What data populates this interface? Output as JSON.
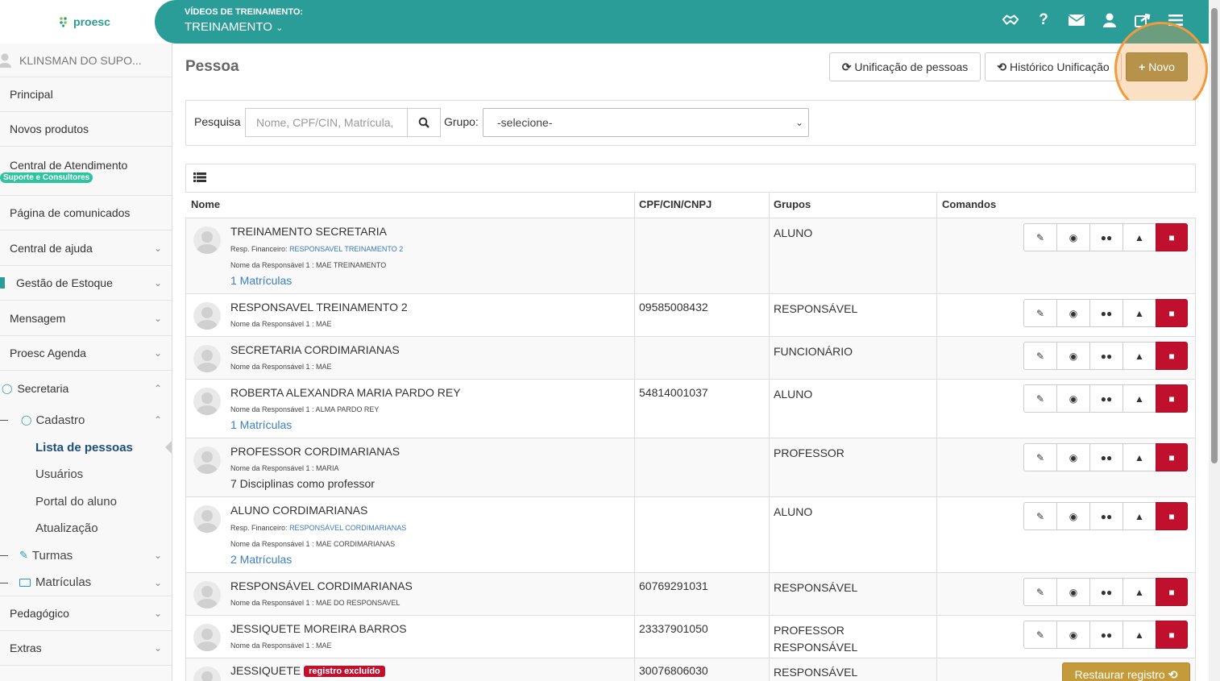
{
  "header": {
    "logo_text": "proesc",
    "video_label": "VÍDEOS DE TREINAMENTO:",
    "video_select": "TREINAMENTO",
    "icons": [
      "handshake-icon",
      "help-icon",
      "envelope-icon",
      "user-icon",
      "share-icon",
      "menu-icon"
    ]
  },
  "sidebar": {
    "user": "KLINSMAN DO SUPO...",
    "items": [
      {
        "label": "Principal"
      },
      {
        "label": "Novos produtos"
      },
      {
        "label": "Central de Atendimento",
        "badge": "Suporte e Consultores"
      },
      {
        "label": "Página de comunicados"
      },
      {
        "label": "Central de ajuda"
      },
      {
        "label": "Gestão de Estoque"
      },
      {
        "label": "Mensagem"
      },
      {
        "label": "Proesc Agenda"
      },
      {
        "label": "Secretaria"
      }
    ],
    "cadastro": "Cadastro",
    "sub_items": [
      "Lista de pessoas",
      "Usuários",
      "Portal do aluno",
      "Atualização"
    ],
    "turmas": "Turmas",
    "matriculas": "Matrículas",
    "pedagogico": "Pedagógico",
    "extras": "Extras"
  },
  "main": {
    "title": "Pessoa",
    "btn_unificacao": "Unificação de pessoas",
    "btn_historico": "Histórico Unificação",
    "btn_novo": "Novo",
    "search_label": "Pesquisa",
    "search_placeholder": "Nome, CPF/CIN, Matrícula,",
    "group_label": "Grupo:",
    "group_value": "-selecione-",
    "columns": [
      "Nome",
      "CPF/CIN/CNPJ",
      "Grupos",
      "Comandos"
    ],
    "restore_label": "Restaurar registro",
    "deleted_badge": "registro excluído"
  },
  "rows": [
    {
      "name": "TREINAMENTO SECRETARIA",
      "resp_fin_label": "Resp. Financeiro:",
      "resp_fin": "RESPONSAVEL TREINAMENTO 2",
      "resp": "Nome da Responsável 1 : MAE TREINAMENTO",
      "extra": "1 Matrículas",
      "cpf": "",
      "groups": [
        "ALUNO"
      ]
    },
    {
      "name": "RESPONSAVEL TREINAMENTO 2",
      "resp": "Nome da Responsável 1 : MAE",
      "cpf": "09585008432",
      "groups": [
        "RESPONSÁVEL"
      ]
    },
    {
      "name": "SECRETARIA CORDIMARIANAS",
      "resp": "Nome da Responsável 1 : MAE",
      "cpf": "",
      "groups": [
        "FUNCIONÁRIO"
      ]
    },
    {
      "name": "ROBERTA ALEXANDRA MARIA PARDO REY",
      "resp": "Nome da Responsável 1 : ALMA PARDO REY",
      "extra": "1 Matrículas",
      "cpf": "54814001037",
      "groups": [
        "ALUNO"
      ]
    },
    {
      "name": "PROFESSOR CORDIMARIANAS",
      "resp": "Nome da Responsável 1 : MARIA",
      "extra": "7 Disciplinas como professor",
      "cpf": "",
      "groups": [
        "PROFESSOR"
      ]
    },
    {
      "name": "ALUNO CORDIMARIANAS",
      "resp_fin_label": "Resp. Financeiro:",
      "resp_fin": "RESPONSÁVEL CORDIMARIANAS",
      "resp": "Nome da Responsável 1 : MAE CORDIMARIANAS",
      "extra": "2 Matrículas",
      "cpf": "",
      "groups": [
        "ALUNO"
      ]
    },
    {
      "name": "RESPONSÁVEL CORDIMARIANAS",
      "resp": "Nome da Responsável 1 : MAE DO RESPONSAVEL",
      "cpf": "60769291031",
      "groups": [
        "RESPONSÁVEL"
      ]
    },
    {
      "name": "JESSIQUETE MOREIRA BARROS",
      "resp": "Nome da Responsável 1 : MAE",
      "cpf": "23337901050",
      "groups": [
        "PROFESSOR",
        "RESPONSÁVEL"
      ]
    },
    {
      "name": "JESSIQUETE",
      "cpf": "30076806030",
      "groups": [
        "RESPONSÁVEL"
      ]
    }
  ]
}
